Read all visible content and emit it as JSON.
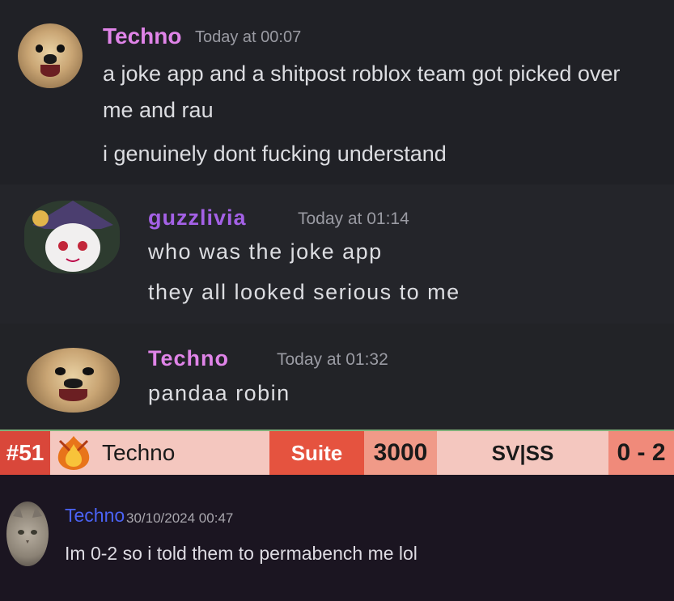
{
  "conversation": [
    {
      "author": "Techno",
      "timestamp": "Today at 00:07",
      "lines": [
        "a joke app and a shitpost roblox team got picked over",
        "me and rau",
        "i genuinely dont fucking understand"
      ]
    },
    {
      "author": "guzzlivia",
      "timestamp": "Today at 01:14",
      "lines": [
        "who was the joke app",
        "they all looked serious to me"
      ]
    },
    {
      "author": "Techno",
      "timestamp": "Today at 01:32",
      "lines": [
        "pandaa robin"
      ]
    }
  ],
  "roster_row": {
    "rank": "#51",
    "player": "Techno",
    "team": "Suite",
    "rating": "3000",
    "tier": "SV|SS",
    "record": "0 - 2"
  },
  "footer_message": {
    "author": "Techno",
    "timestamp": "30/10/2024 00:47",
    "text": "Im 0-2 so i told them to permabench me lol"
  },
  "colors": {
    "techno_name": "#e084e8",
    "guzzlivia_name": "#a461e6",
    "footer_name": "#4b63f5",
    "rank_cell": "#d9473a",
    "team_cell": "#e5533f",
    "rating_cell": "#f09a88",
    "record_cell": "#f08a7a"
  },
  "icons": [
    "dog-avatar",
    "anime-avatar",
    "cat-avatar",
    "flame-bird-icon"
  ]
}
